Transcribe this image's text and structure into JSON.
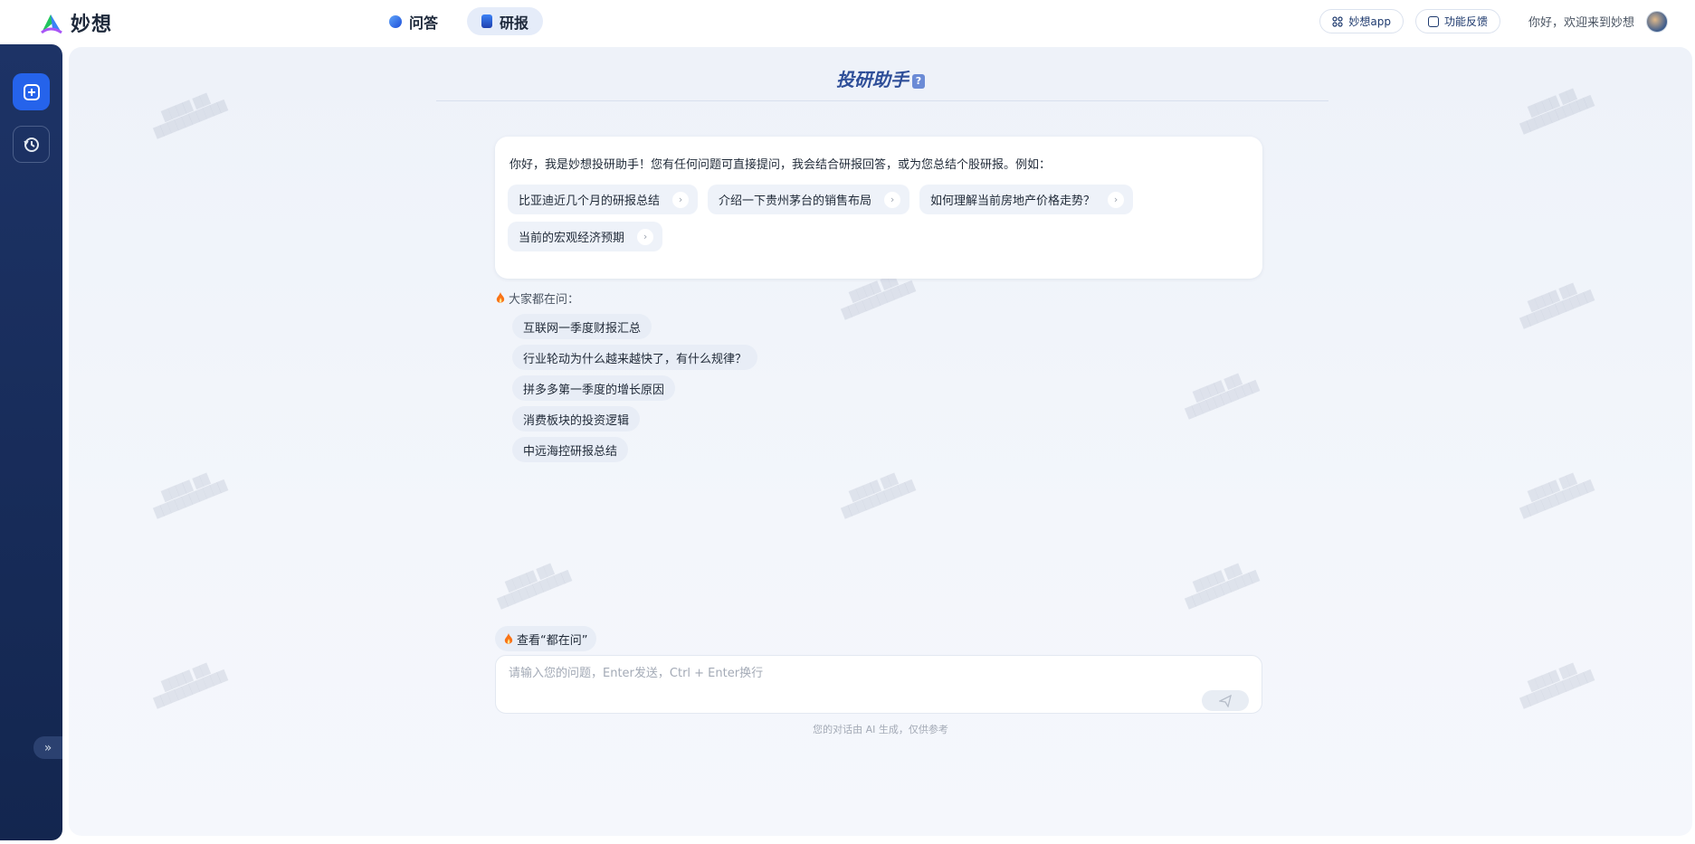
{
  "app": {
    "logo_text": "妙想",
    "nav_tabs": [
      {
        "label": "问答",
        "icon": "chat-bubble-icon",
        "active": false
      },
      {
        "label": "研报",
        "icon": "book-icon",
        "active": true
      }
    ],
    "top_buttons": [
      {
        "label": "妙想app",
        "icon": "grid-icon"
      },
      {
        "label": "功能反馈",
        "icon": "feedback-icon"
      }
    ],
    "greeting": "你好，欢迎来到妙想"
  },
  "sidebar": {
    "new_chat_icon": "plus-square-icon",
    "history_icon": "history-clock-icon",
    "expand_label": "»"
  },
  "main": {
    "title": "投研助手",
    "title_badge": "?",
    "welcome": "你好，我是妙想投研助手！您有任何问题可直接提问，我会结合研报回答，或为您总结个股研报。例如：",
    "examples": [
      "比亚迪近几个月的研报总结",
      "介绍一下贵州茅台的销售布局",
      "如何理解当前房地产价格走势？",
      "当前的宏观经济预期"
    ],
    "popular_title": "大家都在问：",
    "popular": [
      "互联网一季度财报汇总",
      "行业轮动为什么越来越快了，有什么规律？",
      "拼多多第一季度的增长原因",
      "消费板块的投资逻辑",
      "中远海控研报总结"
    ],
    "see_popular": "查看“都在问”",
    "input_placeholder": "请输入您的问题，Enter发送，Ctrl + Enter换行",
    "disclaimer": "您的对话由 AI 生成，仅供参考"
  },
  "colors": {
    "accent": "#2563eb",
    "sidebar": "#1d3366",
    "title": "#2f4f99"
  }
}
